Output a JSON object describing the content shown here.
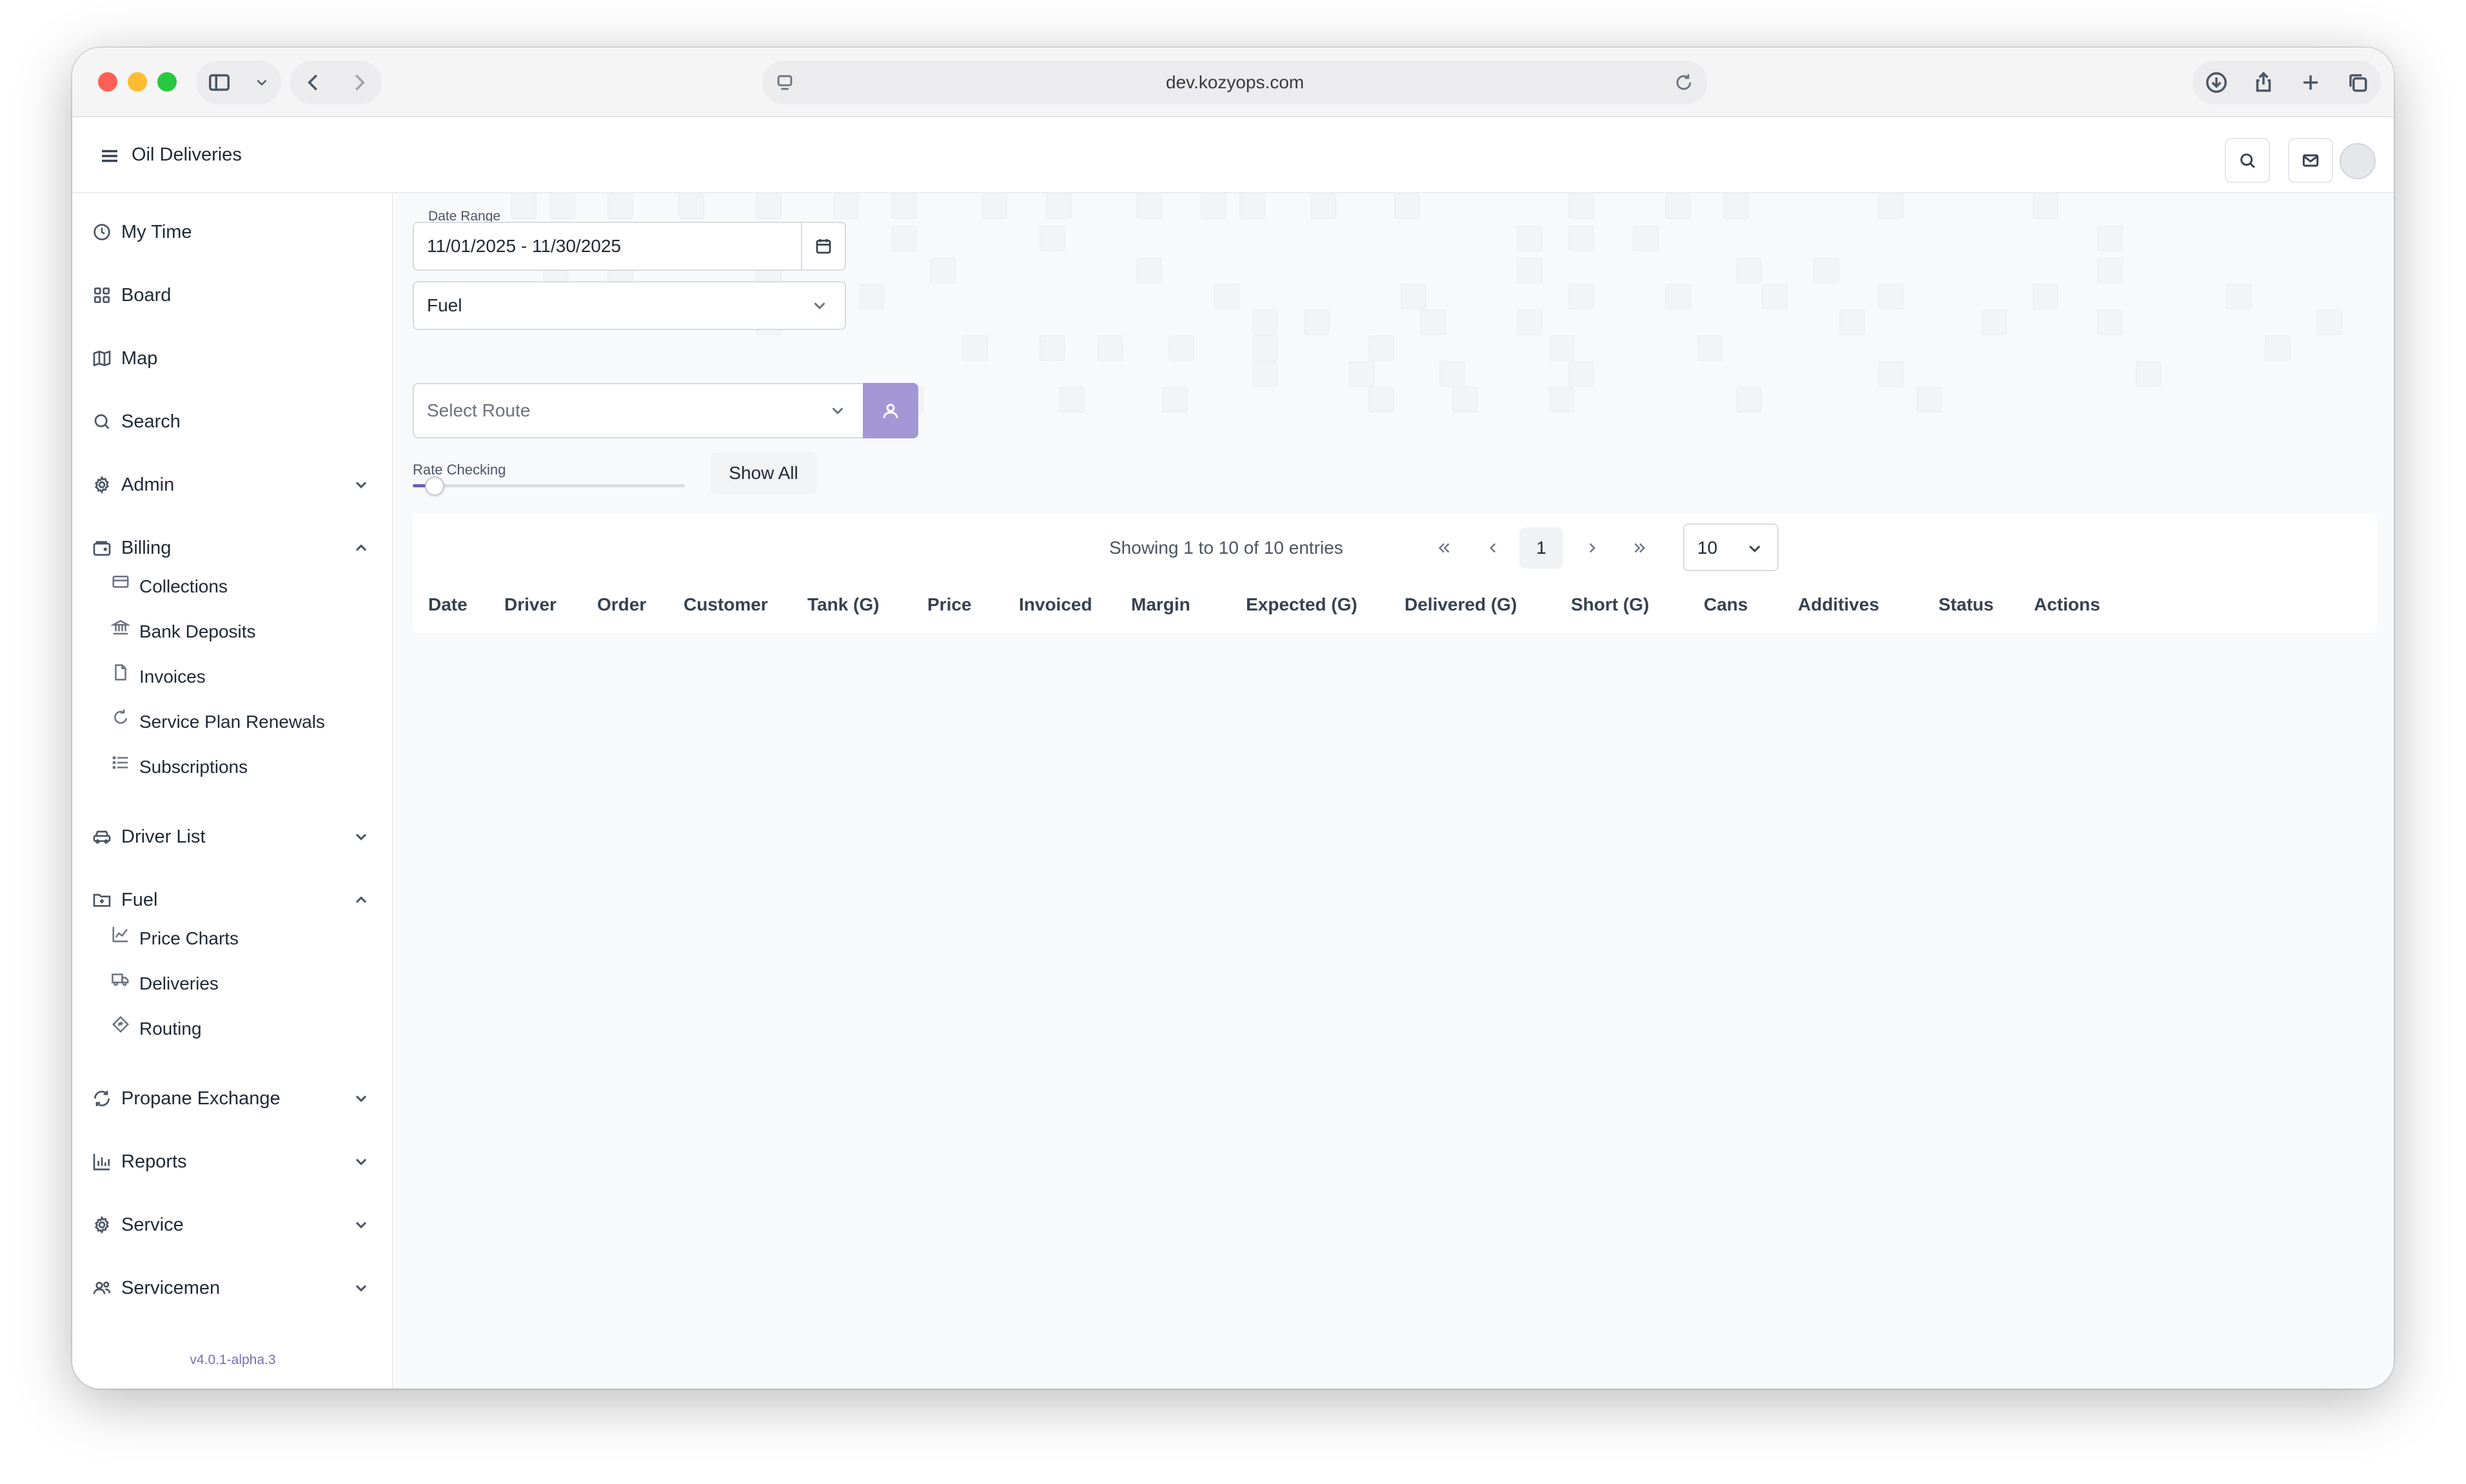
{
  "browser": {
    "url": "dev.kozyops.com"
  },
  "header": {
    "title": "Oil Deliveries"
  },
  "sidebar": {
    "items": [
      {
        "label": "My Time",
        "icon": "clock-icon"
      },
      {
        "label": "Board",
        "icon": "grid-icon"
      },
      {
        "label": "Map",
        "icon": "map-icon"
      },
      {
        "label": "Search",
        "icon": "search-icon"
      },
      {
        "label": "Admin",
        "icon": "gear-icon",
        "expanded": false
      },
      {
        "label": "Billing",
        "icon": "wallet-icon",
        "expanded": true
      },
      {
        "label": "Driver List",
        "icon": "car-icon",
        "expanded": false
      },
      {
        "label": "Fuel",
        "icon": "folder-icon",
        "expanded": true
      },
      {
        "label": "Propane Exchange",
        "icon": "refresh-icon",
        "expanded": false
      },
      {
        "label": "Reports",
        "icon": "bar-chart-icon",
        "expanded": false
      },
      {
        "label": "Service",
        "icon": "gear-icon",
        "expanded": false
      },
      {
        "label": "Servicemen",
        "icon": "users-icon",
        "expanded": false
      }
    ],
    "billing_sub": [
      {
        "label": "Collections",
        "icon": "card-icon"
      },
      {
        "label": "Bank Deposits",
        "icon": "bank-icon"
      },
      {
        "label": "Invoices",
        "icon": "file-icon"
      },
      {
        "label": "Service Plan Renewals",
        "icon": "rotate-icon"
      },
      {
        "label": "Subscriptions",
        "icon": "list-icon"
      }
    ],
    "fuel_sub": [
      {
        "label": "Price Charts",
        "icon": "line-chart-icon"
      },
      {
        "label": "Deliveries",
        "icon": "truck-icon"
      },
      {
        "label": "Routing",
        "icon": "route-icon"
      }
    ],
    "version": "v4.0.1-alpha.3"
  },
  "filters": {
    "date_range_label": "Date Range",
    "date_range_value": "11/01/2025 - 11/30/2025",
    "fuel_value": "Fuel",
    "route_placeholder": "Select Route",
    "rate_checking_label": "Rate Checking",
    "rate_checking_level": 0.08,
    "show_all_label": "Show All"
  },
  "table": {
    "pager_info": "Showing 1 to 10 of 10 entries",
    "current_page": "1",
    "page_size": "10",
    "columns": [
      "Date",
      "Driver",
      "Order",
      "Customer",
      "Tank (G)",
      "Price",
      "Invoiced",
      "Margin",
      "Expected (G)",
      "Delivered (G)",
      "Short (G)",
      "Cans",
      "Additives",
      "Status",
      "Actions"
    ]
  },
  "colors": {
    "accent": "#a397d6",
    "slider": "#6f5fb8",
    "version_text": "#7c6bb8"
  }
}
